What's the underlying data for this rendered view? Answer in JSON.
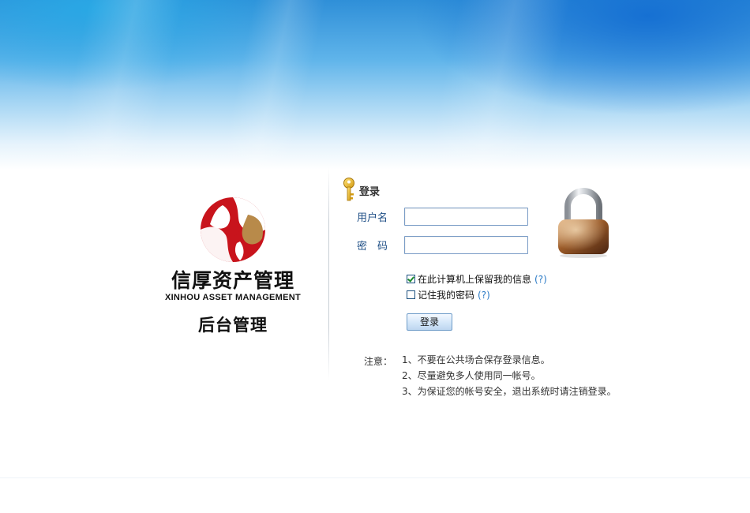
{
  "brand": {
    "name_cn": "信厚资产管理",
    "name_en": "XINHOU ASSET MANAGEMENT",
    "subtitle": "后台管理",
    "colors": {
      "red": "#c8141c",
      "gold": "#b88a4a"
    }
  },
  "login": {
    "title": "登录",
    "username_label": "用户名",
    "username_value": "",
    "password_label": "密　码",
    "password_value": "",
    "remember_info_label": "在此计算机上保留我的信息",
    "remember_info_checked": true,
    "remember_password_label": "记住我的密码",
    "remember_password_checked": false,
    "help_text": "(?)",
    "submit_label": "登录"
  },
  "notes": {
    "label": "注意：",
    "items": [
      "1、不要在公共场合保存登录信息。",
      "2、尽量避免多人使用同一帐号。",
      "3、为保证您的帐号安全，退出系统时请注销登录。"
    ]
  },
  "icons": {
    "key": "key-icon",
    "lock": "padlock-icon",
    "logo": "xinhou-logo"
  },
  "colors": {
    "banner_blue": "#2f8fd8",
    "label_blue": "#1f4f86",
    "help_blue": "#2a7ac6"
  }
}
